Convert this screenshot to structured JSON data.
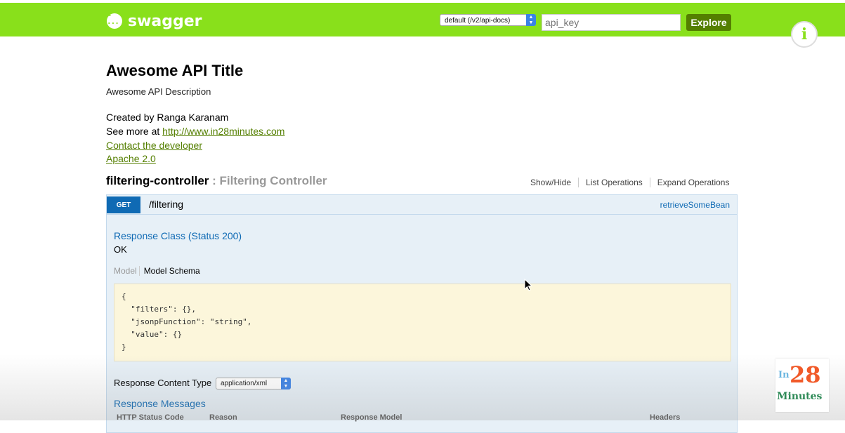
{
  "header": {
    "logo_mark": "{ ... }",
    "logo_text": "swagger",
    "api_select": "default (/v2/api-docs)",
    "api_key_placeholder": "api_key",
    "explore_label": "Explore",
    "info_icon": "i"
  },
  "api_info": {
    "title": "Awesome API Title",
    "description": "Awesome API Description",
    "created_by": "Created by Ranga Karanam",
    "see_more_prefix": "See more at ",
    "see_more_link": "http://www.in28minutes.com",
    "contact": "Contact the developer",
    "license": "Apache 2.0"
  },
  "controller": {
    "name": "filtering-controller",
    "description": " : Filtering Controller",
    "actions": [
      "Show/Hide",
      "List Operations",
      "Expand Operations"
    ]
  },
  "operation": {
    "method": "GET",
    "path": "/filtering",
    "nickname": "retrieveSomeBean",
    "response_class_title": "Response Class (Status 200)",
    "response_class_value": "OK",
    "model_tab": "Model",
    "model_schema_tab": "Model Schema",
    "schema_json": "{\n  \"filters\": {},\n  \"jsonpFunction\": \"string\",\n  \"value\": {}\n}",
    "response_content_type_label": "Response Content Type",
    "response_content_type": "application/xml",
    "response_messages_title": "Response Messages",
    "response_columns": [
      "HTTP Status Code",
      "Reason",
      "Response Model",
      "Headers"
    ]
  },
  "watermark": {
    "prefix": "In",
    "number": "28",
    "suffix": "Minutes"
  },
  "colors": {
    "header_bg": "#89e01b",
    "explore_bg": "#547f00",
    "get_badge": "#0f6ab4",
    "op_panel_bg": "#e7f0f7",
    "schema_bg": "#fcf6db"
  }
}
